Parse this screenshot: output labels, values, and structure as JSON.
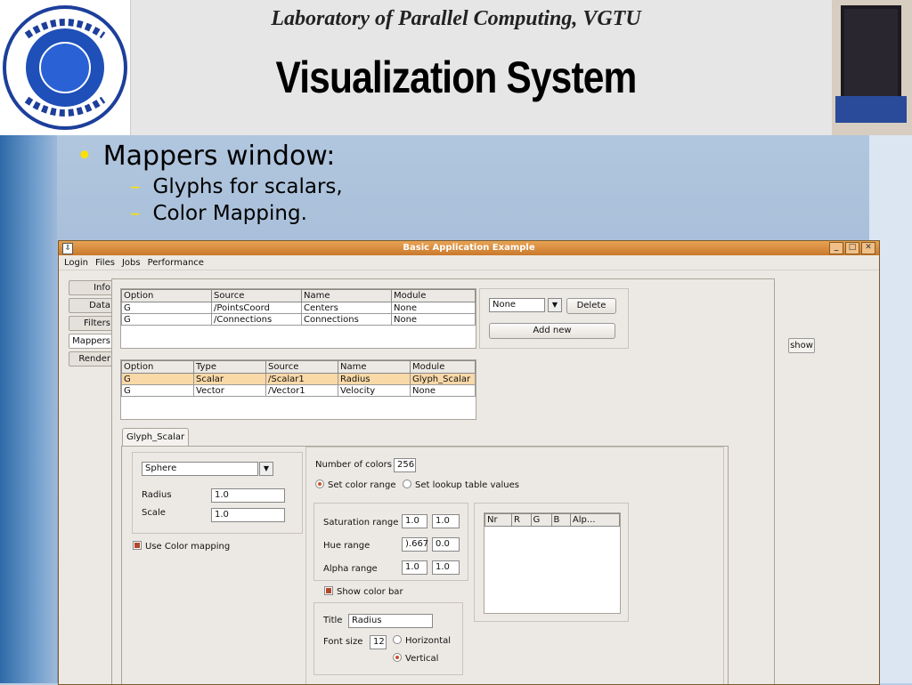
{
  "slide": {
    "kicker": "Laboratory of Parallel Computing, VGTU",
    "title": "Visualization System",
    "bullet": "Mappers window:",
    "subbullets": [
      "Glyphs for scalars,",
      "Color Mapping."
    ],
    "logo_text": "VILNIAUS GEDIMINO TECHNIKOS UNIVERSITETAS SAPERE AUDE"
  },
  "window": {
    "title": "Basic Application Example",
    "menu": [
      "Login",
      "Files",
      "Jobs",
      "Performance"
    ],
    "side_tabs": [
      "Info",
      "Data",
      "Filters",
      "Mappers",
      "Render"
    ],
    "show_label": "show",
    "table1": {
      "headers": [
        "Option",
        "Source",
        "Name",
        "Module"
      ],
      "rows": [
        [
          "G",
          "/PointsCoord",
          "Centers",
          "None"
        ],
        [
          "G",
          "/Connections",
          "Connections",
          "None"
        ]
      ]
    },
    "select_none": "None",
    "delete_label": "Delete",
    "add_new_label": "Add new",
    "table2": {
      "headers": [
        "Option",
        "Type",
        "Source",
        "Name",
        "Module"
      ],
      "rows": [
        [
          "G",
          "Scalar",
          "/Scalar1",
          "Radius",
          "Glyph_Scalar"
        ],
        [
          "G",
          "Vector",
          "/Vector1",
          "Velocity",
          "None"
        ]
      ]
    },
    "glyph_tab": "Glyph_Scalar",
    "shape": "Sphere",
    "radius_label": "Radius",
    "radius_value": "1.0",
    "scale_label": "Scale",
    "scale_value": "1.0",
    "use_color_mapping": "Use Color mapping",
    "num_colors_label": "Number of colors",
    "num_colors_value": "256",
    "set_color_range": "Set color range",
    "set_lookup": "Set lookup table values",
    "saturation_label": "Saturation range",
    "saturation_min": "1.0",
    "saturation_max": "1.0",
    "hue_label": "Hue range",
    "hue_min": ").667",
    "hue_max": "0.0",
    "alpha_label": "Alpha range",
    "alpha_min": "1.0",
    "alpha_max": "1.0",
    "lut_headers": [
      "Nr",
      "R",
      "G",
      "B",
      "Alp..."
    ],
    "show_color_bar": "Show color bar",
    "title_label": "Title",
    "title_value": "Radius",
    "font_size_label": "Font size",
    "font_size_value": "12",
    "horizontal": "Horizontal",
    "vertical": "Vertical"
  }
}
